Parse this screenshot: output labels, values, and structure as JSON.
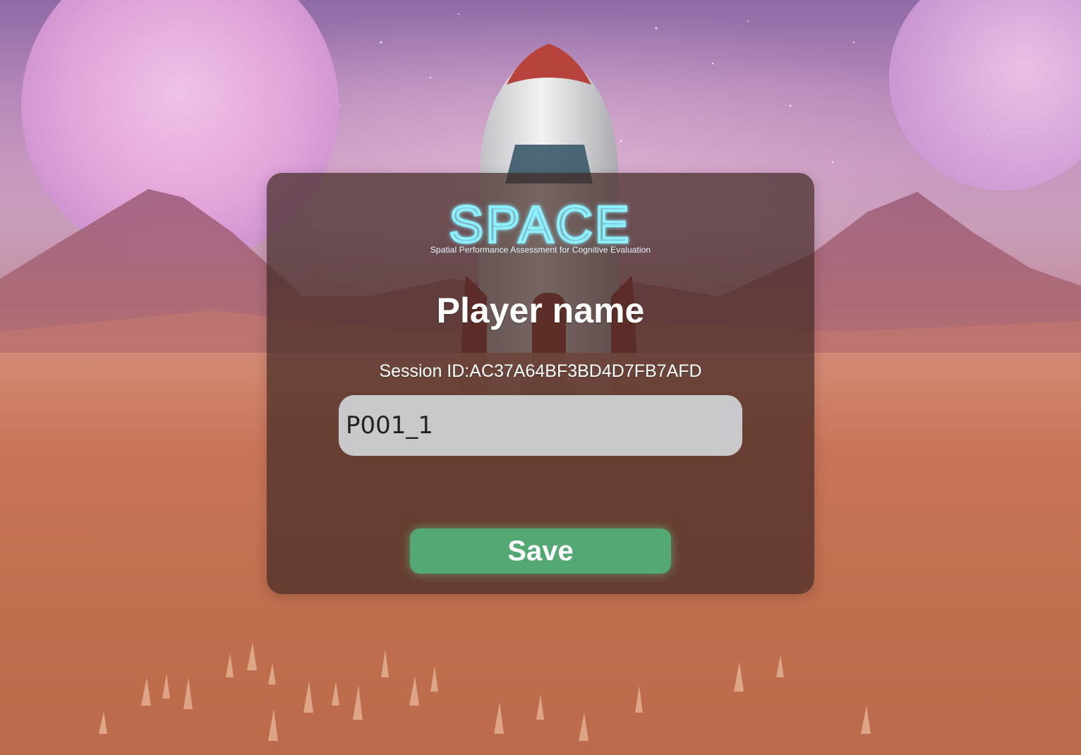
{
  "logo": {
    "title": "SPACE",
    "tagline": "Spatial Performance Assessment for Cognitive Evaluation"
  },
  "dialog": {
    "title": "Player name",
    "session_label": "Session ID:",
    "session_id": "AC37A64BF3BD4D7FB7AFD",
    "name_value": "P001_1",
    "save_label": "Save"
  },
  "colors": {
    "panel": "#402824",
    "input_bg": "#c9c9cb",
    "save_button": "#54a873",
    "logo_glow": "#7fe9ff"
  },
  "scene": {
    "background": "mars-like landscape with two pink moons, mountains and a rocket"
  }
}
